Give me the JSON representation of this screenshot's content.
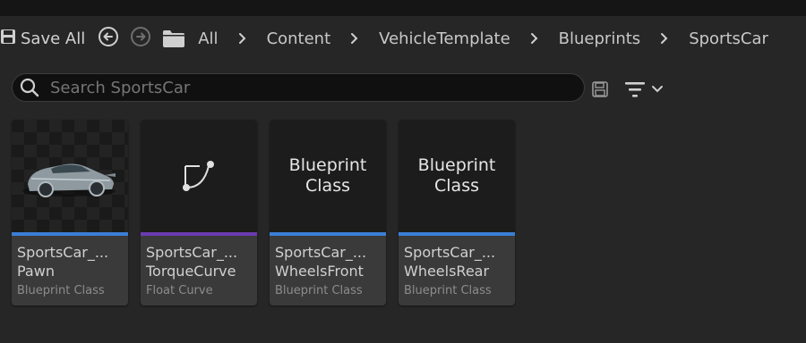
{
  "toolbar": {
    "save_all_label": "Save All",
    "breadcrumb": [
      "All",
      "Content",
      "VehicleTemplate",
      "Blueprints",
      "SportsCar"
    ]
  },
  "search": {
    "placeholder": "Search SportsCar"
  },
  "assets": [
    {
      "name_line1": "SportsCar_...",
      "name_line2": "Pawn",
      "type": "Blueprint Class",
      "bar_color": "#3b7ed6"
    },
    {
      "name_line1": "SportsCar_...",
      "name_line2": "TorqueCurve",
      "type": "Float Curve",
      "bar_color": "#6a3bb0"
    },
    {
      "name_line1": "SportsCar_...",
      "name_line2": "WheelsFront",
      "type": "Blueprint Class",
      "bar_color": "#3b7ed6",
      "thumb_text": "Blueprint Class"
    },
    {
      "name_line1": "SportsCar_...",
      "name_line2": "WheelsRear",
      "type": "Blueprint Class",
      "bar_color": "#3b7ed6",
      "thumb_text": "Blueprint Class"
    }
  ],
  "thumb_labels": {
    "wheels_front": [
      "Blueprint",
      "Class"
    ],
    "wheels_rear": [
      "Blueprint",
      "Class"
    ]
  }
}
